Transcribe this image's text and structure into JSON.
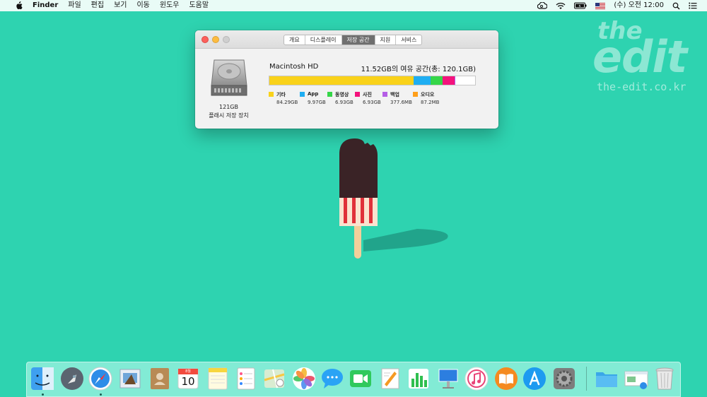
{
  "menubar": {
    "app_name": "Finder",
    "menus": [
      "파일",
      "편집",
      "보기",
      "이동",
      "윈도우",
      "도움말"
    ],
    "clock": "(수) 오전 12:00",
    "icons": [
      "apple-icon",
      "creative-cloud-icon",
      "wifi-icon",
      "battery-icon",
      "us-flag-icon",
      "search-icon",
      "list-icon"
    ]
  },
  "watermark": {
    "the": "the",
    "edit": "edit",
    "url": "the-edit.co.kr"
  },
  "window": {
    "tabs": [
      "개요",
      "디스플레이",
      "저장 공간",
      "지원",
      "서비스"
    ],
    "active_tab": "저장 공간",
    "disk_size": "121GB",
    "disk_type": "플래시 저장 장치",
    "disk_name": "Macintosh HD",
    "free_space": "11.52GB의 여유 공간(총: 120.1GB)",
    "legend": [
      {
        "name": "기타",
        "size": "84.29GB",
        "color": "#f9d21a"
      },
      {
        "name": "App",
        "size": "9.97GB",
        "color": "#1faef2"
      },
      {
        "name": "동영상",
        "size": "6.93GB",
        "color": "#35d648"
      },
      {
        "name": "사진",
        "size": "6.93GB",
        "color": "#f4137c"
      },
      {
        "name": "백업",
        "size": "377.6MB",
        "color": "#b55ee6"
      },
      {
        "name": "오디오",
        "size": "87.2MB",
        "color": "#ff9f1a"
      }
    ],
    "storage_fractions": {
      "other": 0.702,
      "apps": 0.083,
      "movies": 0.058,
      "photos": 0.058,
      "backups": 0.003,
      "audio": 0.001,
      "free": 0.096
    }
  },
  "dock": {
    "items": [
      "Finder",
      "Launchpad",
      "Safari",
      "Mail",
      "Contacts",
      "Calendar",
      "Notes",
      "Reminders",
      "Maps",
      "Photos",
      "Messages",
      "FaceTime",
      "Pages",
      "Numbers",
      "Keynote",
      "iTunes",
      "iBooks",
      "App Store",
      "System Preferences",
      "Downloads",
      "Preview",
      "Trash"
    ],
    "calendar_day": "10",
    "calendar_month": "8월"
  }
}
